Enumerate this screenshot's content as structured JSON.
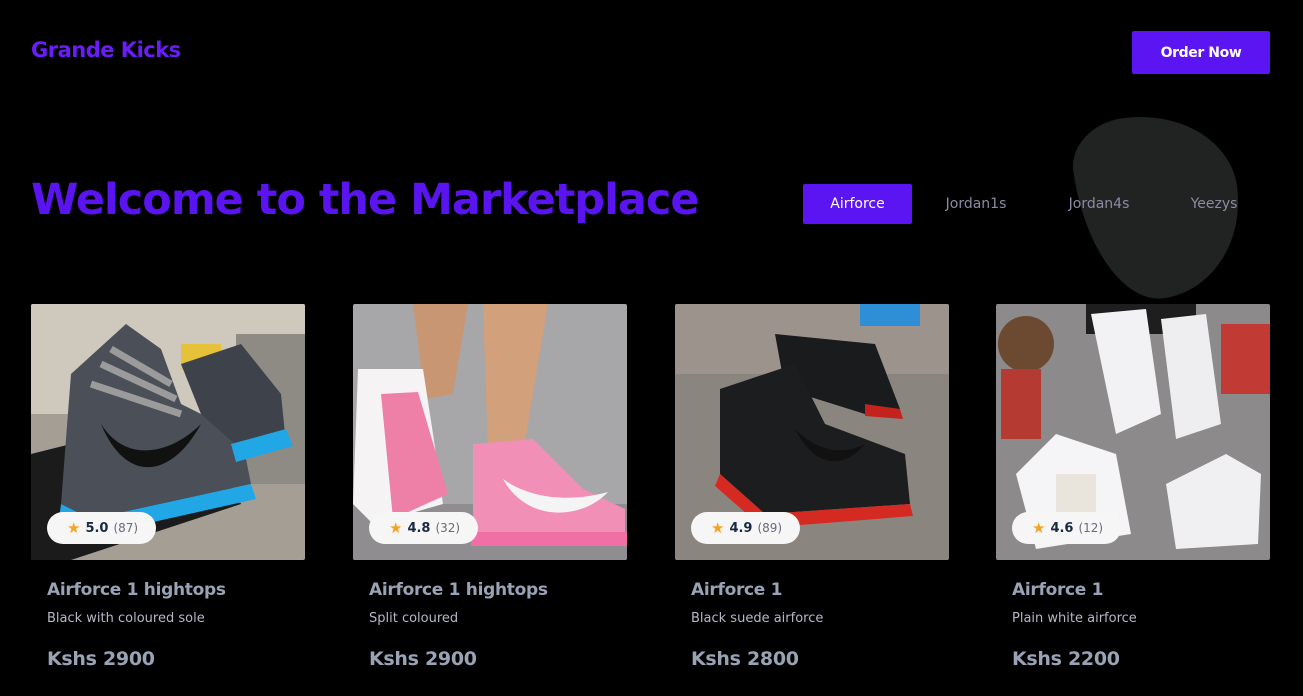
{
  "header": {
    "brand": "Grande Kicks",
    "order_button": "Order Now"
  },
  "hero": {
    "title": "Welcome to the Marketplace"
  },
  "tabs": [
    {
      "label": "Airforce",
      "active": true
    },
    {
      "label": "Jordan1s",
      "active": false
    },
    {
      "label": "Jordan4s",
      "active": false
    },
    {
      "label": "Yeezys",
      "active": false
    }
  ],
  "products": [
    {
      "name": "Airforce 1 hightops",
      "description": "Black with coloured sole",
      "price": "Kshs 2900",
      "rating": "5.0",
      "reviews": "(87)"
    },
    {
      "name": "Airforce 1 hightops",
      "description": "Split coloured",
      "price": "Kshs 2900",
      "rating": "4.8",
      "reviews": "(32)"
    },
    {
      "name": "Airforce 1",
      "description": "Black suede airforce",
      "price": "Kshs 2800",
      "rating": "4.9",
      "reviews": "(89)"
    },
    {
      "name": "Airforce 1",
      "description": "Plain white airforce",
      "price": "Kshs 2200",
      "rating": "4.6",
      "reviews": "(12)"
    }
  ],
  "colors": {
    "brand": "#6a1df7",
    "accent": "#5b14f2",
    "background": "#000000",
    "star": "#f3a425"
  },
  "icons": {
    "rating": "star-icon"
  }
}
